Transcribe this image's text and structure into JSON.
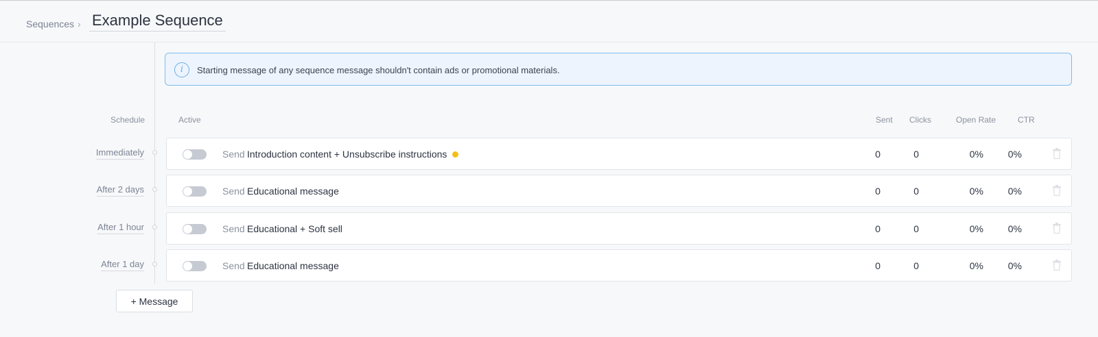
{
  "breadcrumb": {
    "parent": "Sequences",
    "separator": "›",
    "title": "Example Sequence"
  },
  "notice": {
    "icon": "info-icon",
    "icon_glyph": "i",
    "text": "Starting message of any sequence message shouldn't contain ads or promotional materials."
  },
  "columns": {
    "schedule": "Schedule",
    "active": "Active",
    "sent": "Sent",
    "clicks": "Clicks",
    "open_rate": "Open Rate",
    "ctr": "CTR"
  },
  "messages": [
    {
      "schedule": "Immediately",
      "active": false,
      "send_label": "Send",
      "name": "Introduction content + Unsubscribe instructions",
      "has_warning_dot": true,
      "sent": "0",
      "clicks": "0",
      "open_rate": "0%",
      "ctr": "0%"
    },
    {
      "schedule": "After 2 days",
      "active": false,
      "send_label": "Send",
      "name": "Educational message",
      "has_warning_dot": false,
      "sent": "0",
      "clicks": "0",
      "open_rate": "0%",
      "ctr": "0%"
    },
    {
      "schedule": "After 1 hour",
      "active": false,
      "send_label": "Send",
      "name": "Educational + Soft sell",
      "has_warning_dot": false,
      "sent": "0",
      "clicks": "0",
      "open_rate": "0%",
      "ctr": "0%"
    },
    {
      "schedule": "After 1 day",
      "active": false,
      "send_label": "Send",
      "name": "Educational message",
      "has_warning_dot": false,
      "sent": "0",
      "clicks": "0",
      "open_rate": "0%",
      "ctr": "0%"
    }
  ],
  "add_button": "+ Message",
  "colors": {
    "notice_border": "#7fbcec",
    "notice_bg": "#eef4fd",
    "warning_dot": "#f5be18",
    "toggle_off": "#c5cad3"
  }
}
